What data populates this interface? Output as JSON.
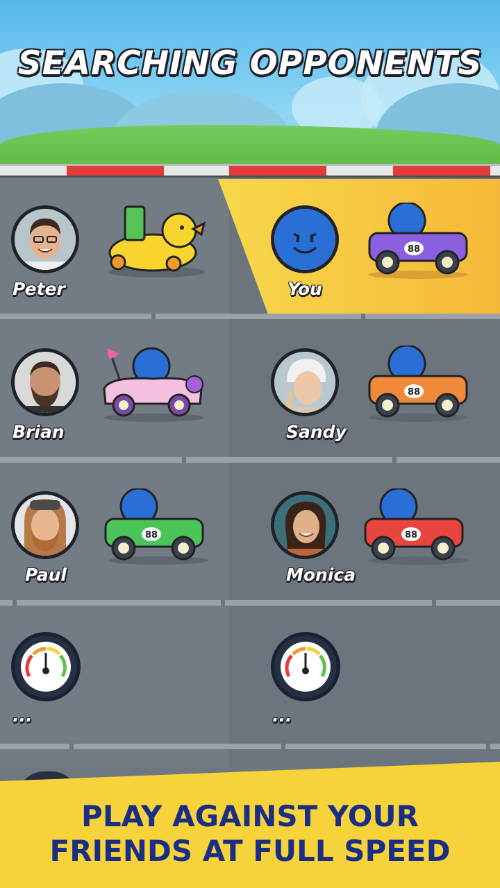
{
  "title": "SEARCHING OPPONENTS",
  "players": [
    {
      "name": "Peter"
    },
    {
      "name": "You"
    },
    {
      "name": "Brian"
    },
    {
      "name": "Sandy"
    },
    {
      "name": "Paul"
    },
    {
      "name": "Monica"
    }
  ],
  "searching": [
    {
      "label": "..."
    },
    {
      "label": "..."
    }
  ],
  "car_number": "88",
  "banner": {
    "line1": "PLAY AGAINST YOUR",
    "line2": "FRIENDS AT FULL SPEED"
  },
  "colors": {
    "banner_bg": "#f7d33b",
    "banner_text": "#1a2e86",
    "you_highlight": "#f6c83f",
    "track": "#6c757e",
    "ball": "#2a6fd6"
  }
}
